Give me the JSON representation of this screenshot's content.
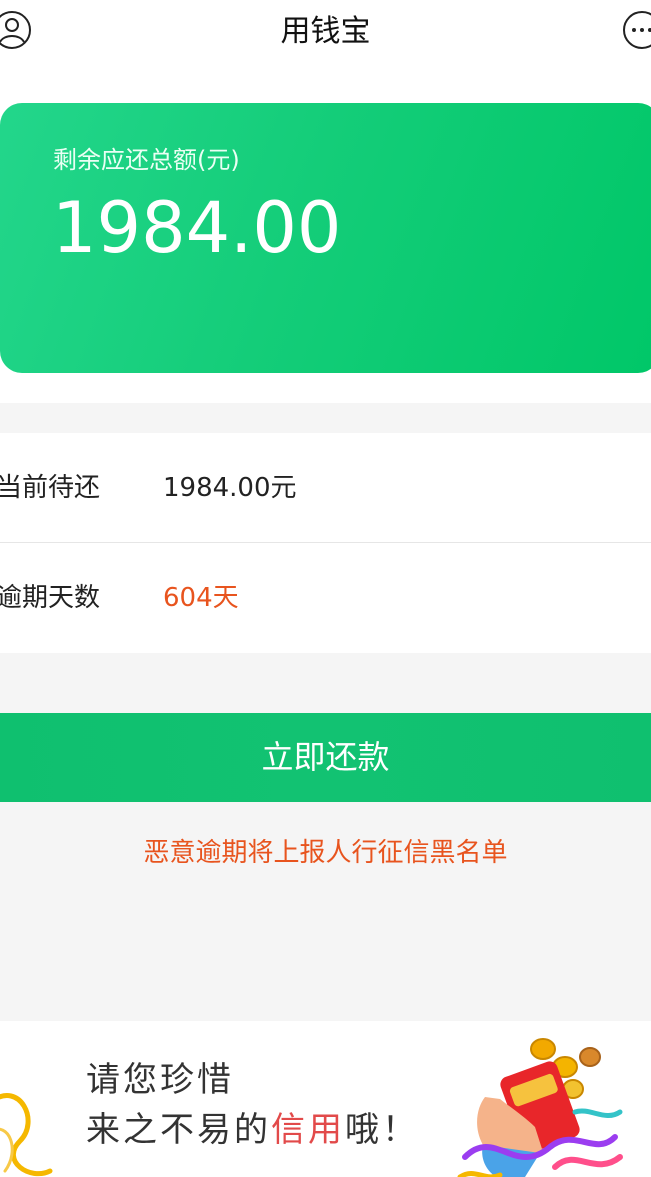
{
  "header": {
    "title": "用钱宝",
    "left_icon": "user-icon",
    "right_icon": "more-icon"
  },
  "amount_card": {
    "label": "剩余应还总额(元)",
    "amount": "1984.00"
  },
  "info": {
    "rows": [
      {
        "key": "当前待还",
        "value": "1984.00元"
      },
      {
        "key": "逾期天数",
        "value": "604天"
      }
    ]
  },
  "repay_button": {
    "label": "立即还款"
  },
  "warning": "恶意逾期将上报人行征信黑名单",
  "banner": {
    "line1": "请您珍惜",
    "line2_prefix": "来之不易的",
    "line2_highlight": "信用",
    "line2_suffix": "哦！"
  },
  "colors": {
    "brand_green": "#12c272",
    "warning_orange": "#e8541e",
    "highlight_red": "#e24a4a"
  }
}
